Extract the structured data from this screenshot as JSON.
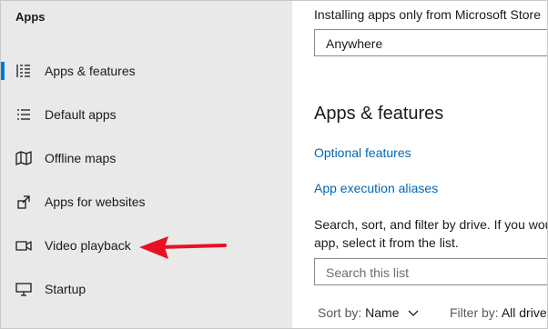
{
  "sidebar": {
    "title": "Apps",
    "items": [
      {
        "label": "Apps & features",
        "icon": "apps-features-icon",
        "selected": true
      },
      {
        "label": "Default apps",
        "icon": "default-apps-icon",
        "selected": false
      },
      {
        "label": "Offline maps",
        "icon": "map-icon",
        "selected": false
      },
      {
        "label": "Apps for websites",
        "icon": "apps-for-websites-icon",
        "selected": false
      },
      {
        "label": "Video playback",
        "icon": "video-icon",
        "selected": false
      },
      {
        "label": "Startup",
        "icon": "startup-icon",
        "selected": false
      }
    ],
    "accent": "#0078d4"
  },
  "annotation": {
    "arrow_color": "#e81123",
    "points_to": "Video playback"
  },
  "main": {
    "install_label": "Installing apps only from Microsoft Store",
    "install_dropdown_value": "Anywhere",
    "section_title": "Apps & features",
    "links": {
      "optional_features": "Optional features",
      "app_execution_aliases": "App execution aliases"
    },
    "description_line1": "Search, sort, and filter by drive. If you wou",
    "description_line2": "app, select it from the list.",
    "search_placeholder": "Search this list",
    "sort": {
      "label": "Sort by:",
      "value": "Name"
    },
    "filter": {
      "label": "Filter by:",
      "value": "All drives"
    },
    "link_color": "#0067b8"
  }
}
